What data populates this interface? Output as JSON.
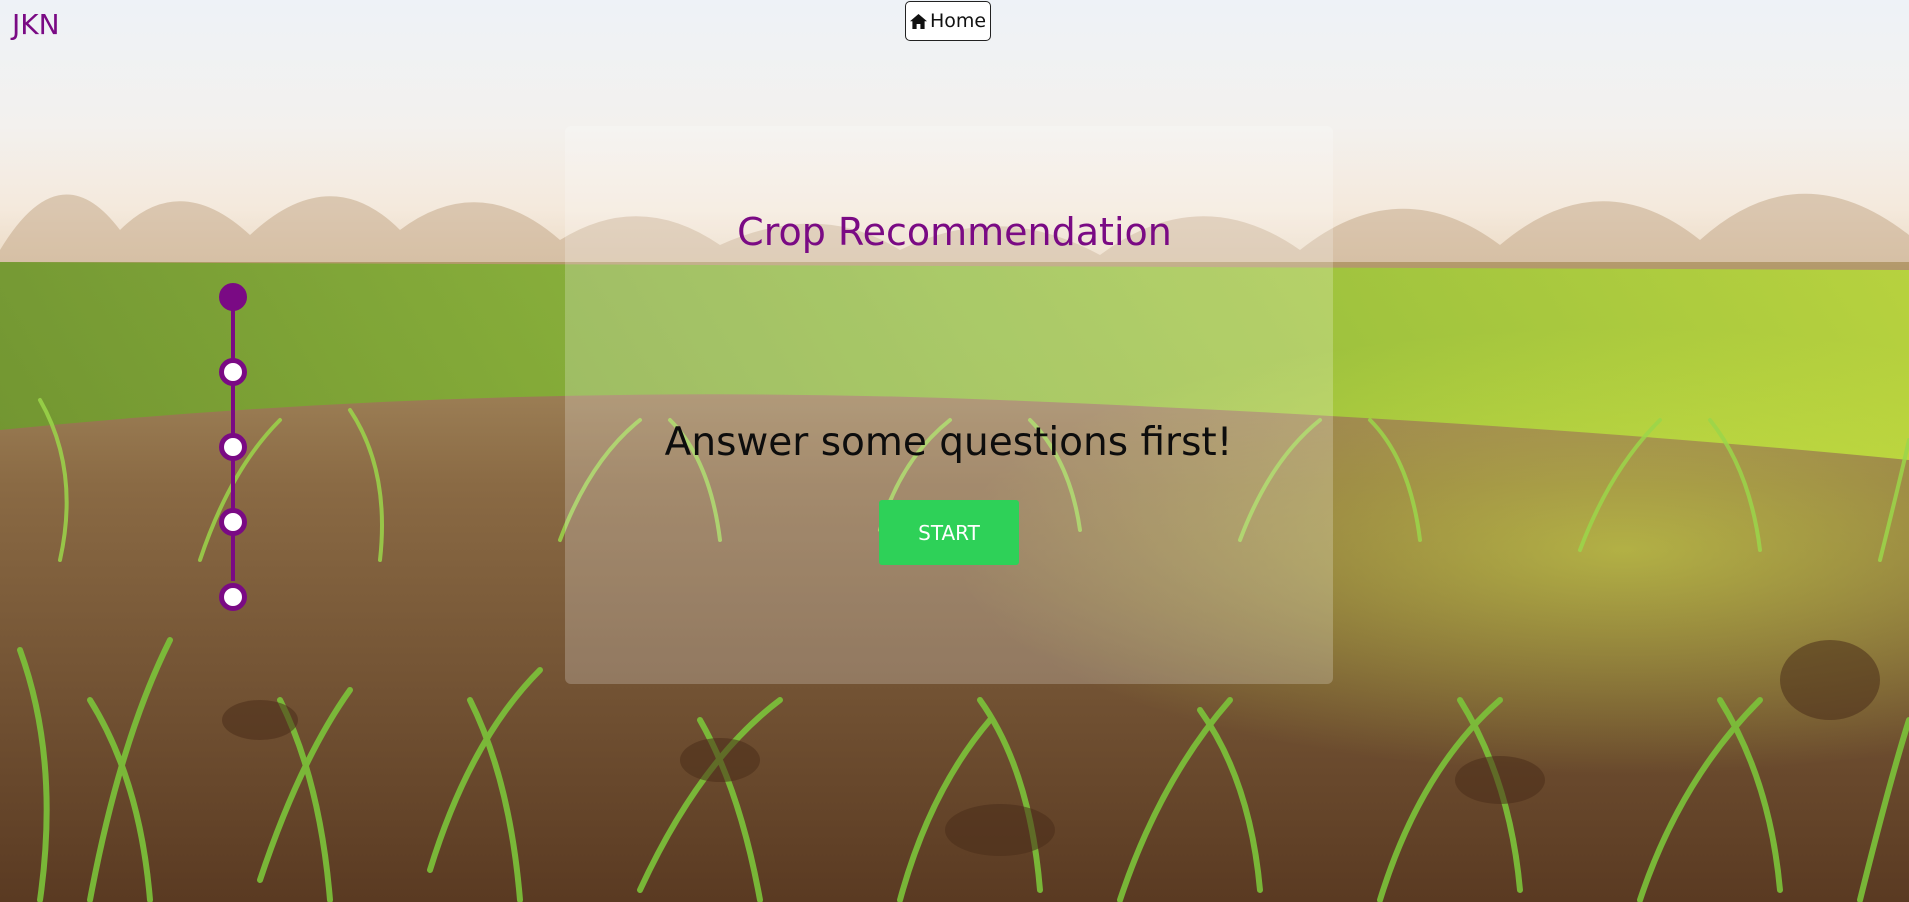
{
  "brand": {
    "label": "JKN"
  },
  "nav": {
    "home_label": "Home",
    "home_icon": "home-icon"
  },
  "panel": {
    "title": "Crop Recommendation",
    "question": "Answer some questions first!",
    "start_label": "START"
  },
  "stepper": {
    "steps": 5,
    "current_step": 1
  },
  "colors": {
    "accent": "#7a0a84",
    "start_button": "#2ed158"
  }
}
